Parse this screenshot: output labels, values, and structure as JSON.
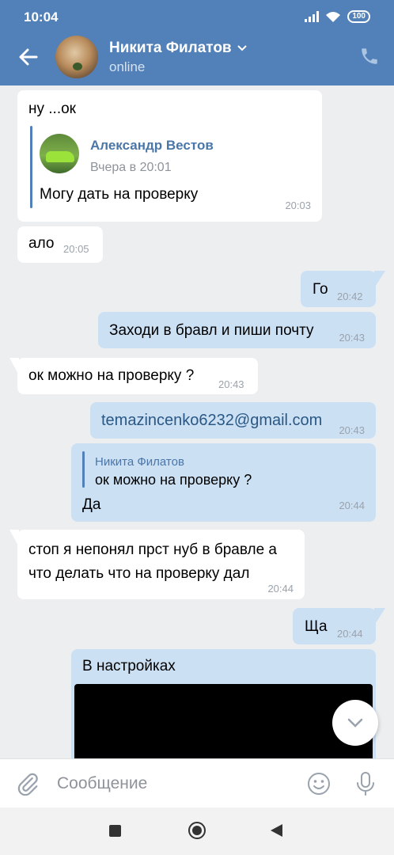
{
  "statusbar": {
    "time": "10:04",
    "battery": "100"
  },
  "header": {
    "name": "Никита Филатов",
    "status": "online"
  },
  "messages": {
    "m1": {
      "text": "ну ...ок",
      "forward_author": "Александр Вестов",
      "forward_date": "Вчера в 20:01",
      "forward_text": "Могу дать на проверку",
      "time": "20:03"
    },
    "m2": {
      "text": "ало",
      "time": "20:05"
    },
    "m3": {
      "text": "Го",
      "time": "20:42"
    },
    "m4": {
      "text": "Заходи в бравл и пиши почту",
      "time": "20:43"
    },
    "m5": {
      "text": "ок можно на проверку ?",
      "time": "20:43"
    },
    "m6": {
      "text": "temazincenko6232@gmail.com",
      "time": "20:43"
    },
    "m7": {
      "reply_author": "Никита Филатов",
      "reply_text": "ок можно на проверку ?",
      "text": "Да",
      "time": "20:44"
    },
    "m8": {
      "line1": "стоп я непонял прст нуб в бравле а",
      "line2": "что делать что на проверку дал",
      "time": "20:44"
    },
    "m9": {
      "text": "Ща",
      "time": "20:44"
    },
    "m10": {
      "text": "В настройках"
    }
  },
  "input": {
    "placeholder": "Сообщение"
  },
  "colors": {
    "header": "#5181b8",
    "outgoing": "#cce0f4",
    "incoming": "#ffffff",
    "background": "#edeef0"
  }
}
